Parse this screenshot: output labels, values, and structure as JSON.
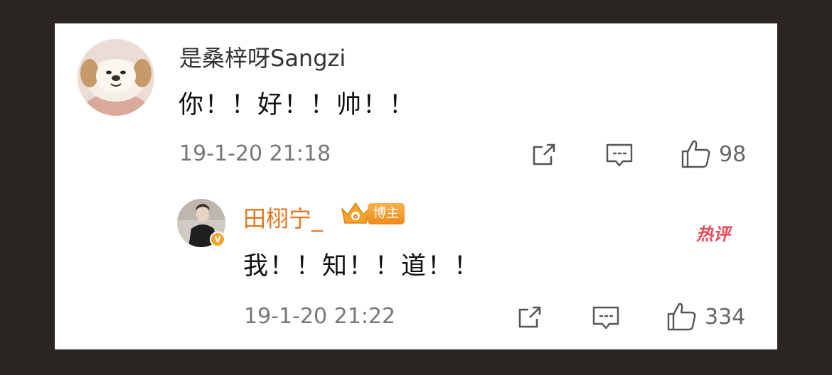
{
  "comment": {
    "username": "是桑梓呀Sangzi",
    "text": "你！！好！！帅！！",
    "timestamp": "19-1-20 21:18",
    "likes": "98"
  },
  "reply": {
    "username": "田栩宁_",
    "badge_label": "博主",
    "text": "我！！知！！道！！",
    "timestamp": "19-1-20 21:22",
    "likes": "334",
    "hot_label": "热评"
  },
  "colors": {
    "frame": "#2b2624",
    "reply_username": "#e3771e",
    "badge_orange": "#f0951f",
    "hot_red": "#e94a58"
  },
  "icons": [
    "share-icon",
    "comment-icon",
    "like-icon",
    "verified-icon",
    "crown-icon"
  ]
}
